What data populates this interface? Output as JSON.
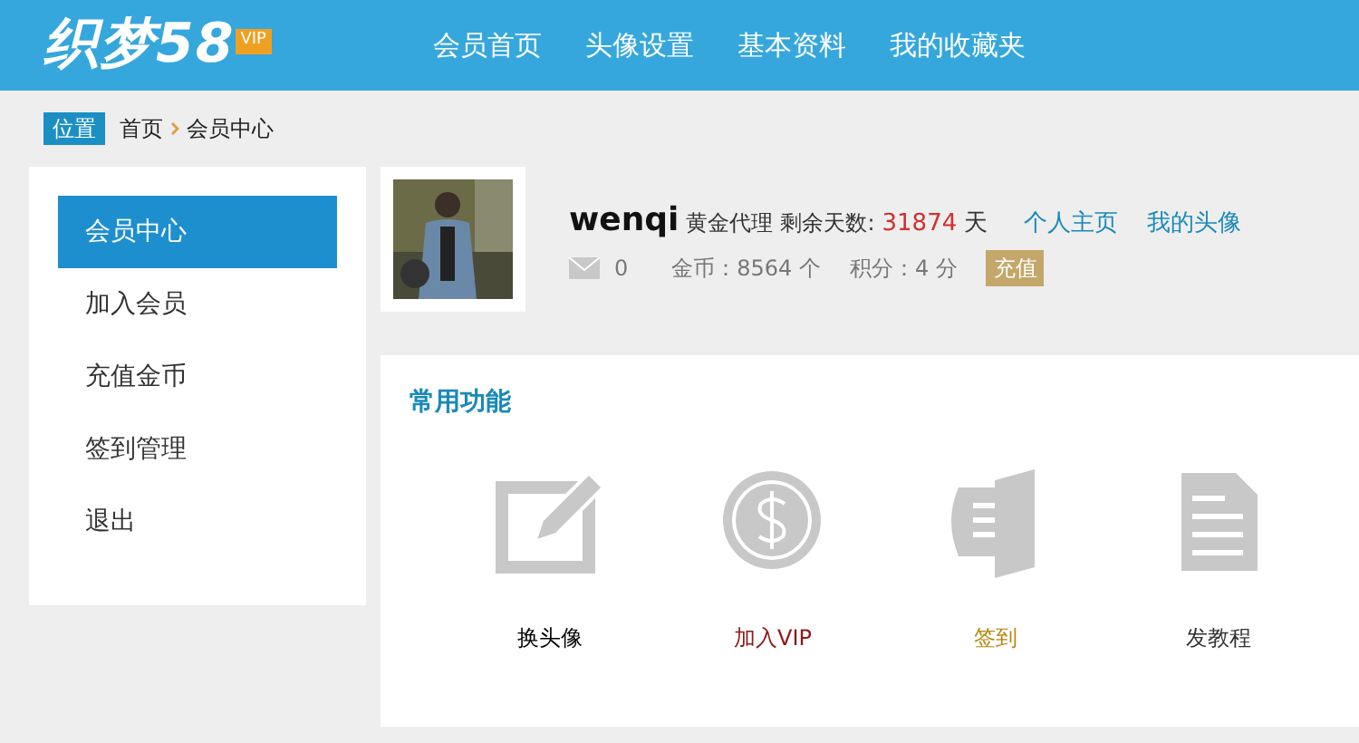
{
  "logo": {
    "text": "织梦58",
    "badge": "VIP"
  },
  "nav": [
    {
      "label": "会员首页"
    },
    {
      "label": "头像设置"
    },
    {
      "label": "基本资料"
    },
    {
      "label": "我的收藏夹"
    }
  ],
  "breadcrumb": {
    "tag": "位置",
    "items": [
      "首页",
      "会员中心"
    ]
  },
  "sidebar": {
    "items": [
      {
        "label": "会员中心",
        "selected": true
      },
      {
        "label": "加入会员",
        "selected": false
      },
      {
        "label": "充值金币",
        "selected": false
      },
      {
        "label": "签到管理",
        "selected": false
      },
      {
        "label": "退出",
        "selected": false
      }
    ]
  },
  "profile": {
    "username": "wenqi",
    "rank": "黄金代理",
    "days_label": "剩余天数:",
    "days": "31874",
    "days_unit": "天",
    "links": [
      "个人主页",
      "我的头像"
    ],
    "messages": "0",
    "coins": "金币：8564 个",
    "points": "积分：4 分",
    "recharge": "充值"
  },
  "functions": {
    "title": "常用功能",
    "items": [
      {
        "kind": "edit",
        "label": "换头像",
        "color": "#000000"
      },
      {
        "kind": "coin",
        "label": "加入VIP",
        "color": "#8b1a1a"
      },
      {
        "kind": "door",
        "label": "签到",
        "color": "#b8860b"
      },
      {
        "kind": "doc",
        "label": "发教程",
        "color": "#333333"
      }
    ]
  }
}
